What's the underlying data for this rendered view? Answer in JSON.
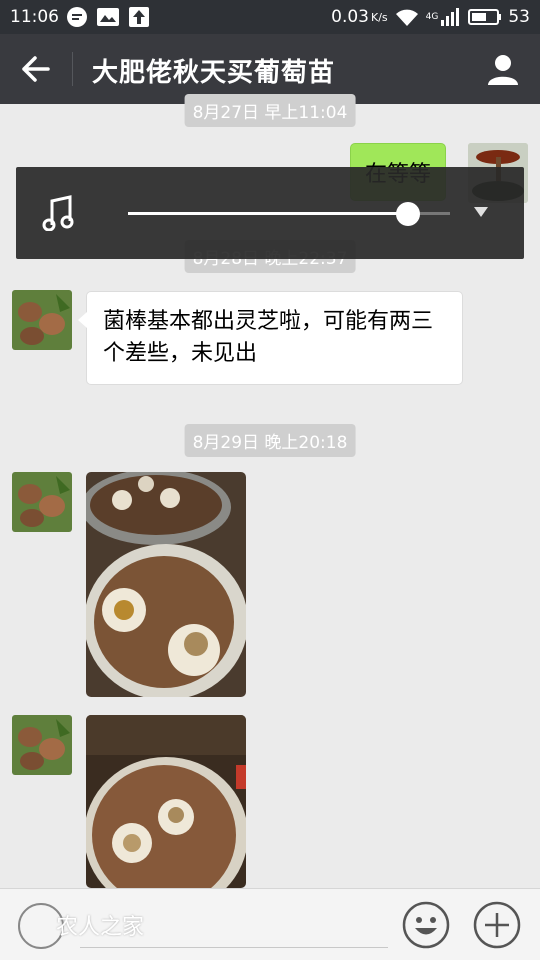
{
  "status": {
    "time": "11:06",
    "speed": "0.03",
    "speed_unit": "K/s",
    "network": "4G",
    "battery": "53"
  },
  "header": {
    "title": "大肥佬秋天买葡萄苗"
  },
  "messages": {
    "ts1": "8月27日 早上11:04",
    "sent_text": "在等等",
    "ts2": "8月28日 晚上22:37",
    "received_text": "菌棒基本都出灵芝啦，可能有两三个差些，未见出",
    "ts3": "8月29日 晚上20:18"
  },
  "player": {
    "progress": 0.87
  },
  "footer": {
    "watermark": "农人之家"
  },
  "icons": [
    "back-arrow-icon",
    "profile-icon",
    "music-note-icon",
    "dropdown-icon",
    "voice-icon",
    "emoji-icon",
    "plus-icon"
  ],
  "colors": {
    "titlebar": "#393a3f",
    "sent_bubble": "#a0e759",
    "background": "#ebebeb"
  }
}
